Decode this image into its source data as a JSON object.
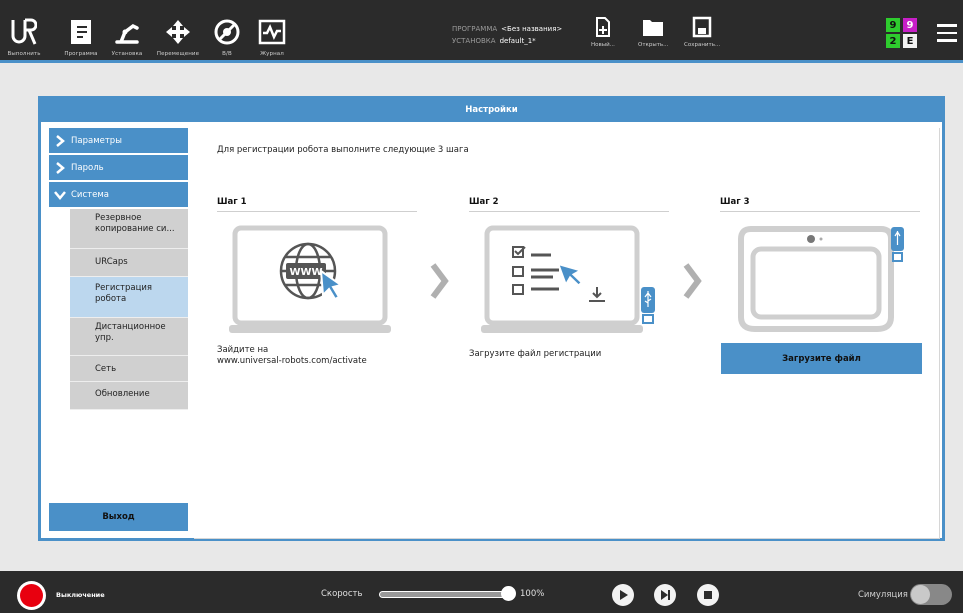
{
  "topbar": {
    "nav": [
      {
        "label": "Выполнить",
        "icon": "ur-logo-icon"
      },
      {
        "label": "Программа",
        "icon": "program-icon"
      },
      {
        "label": "Установка",
        "icon": "installation-icon"
      },
      {
        "label": "Перемещение",
        "icon": "move-icon"
      },
      {
        "label": "В/В",
        "icon": "io-icon"
      },
      {
        "label": "Журнал",
        "icon": "log-icon"
      }
    ],
    "program_label": "ПРОГРАММА",
    "program_value": "<Без названия>",
    "installation_label": "УСТАНОВКА",
    "installation_value": "default_1*",
    "new_label": "Новый...",
    "open_label": "Открыть...",
    "save_label": "Сохранить...",
    "badges": [
      "9",
      "9",
      "2",
      "E"
    ]
  },
  "dialog": {
    "title": "Настройки",
    "sidebar": {
      "sections": [
        "Параметры",
        "Пароль",
        "Система"
      ],
      "subitems": [
        "Резервное копирование си...",
        "URCaps",
        "Регистрация робота",
        "Дистанционное упр.",
        "Сеть",
        "Обновление"
      ],
      "exit_label": "Выход"
    },
    "intro": "Для регистрации робота выполните следующие 3 шага",
    "steps": [
      {
        "title": "Шаг 1",
        "text_line1": "Зайдите на",
        "text_line2": "www.universal-robots.com/activate"
      },
      {
        "title": "Шаг 2",
        "text_line1": "Загрузите файл регистрации"
      },
      {
        "title": "Шаг 3",
        "button": "Загрузите файл"
      }
    ],
    "www_text": "WWW"
  },
  "bottombar": {
    "status": "Выключение",
    "speed_label": "Скорость",
    "speed_value": "100%",
    "speed_fraction": 1.0,
    "simulation_label": "Симуляция"
  },
  "colors": {
    "accent": "#4a90c8",
    "badge_green": "#2ecc2e",
    "badge_magenta": "#c81fc8",
    "power_red": "#e8000f"
  }
}
